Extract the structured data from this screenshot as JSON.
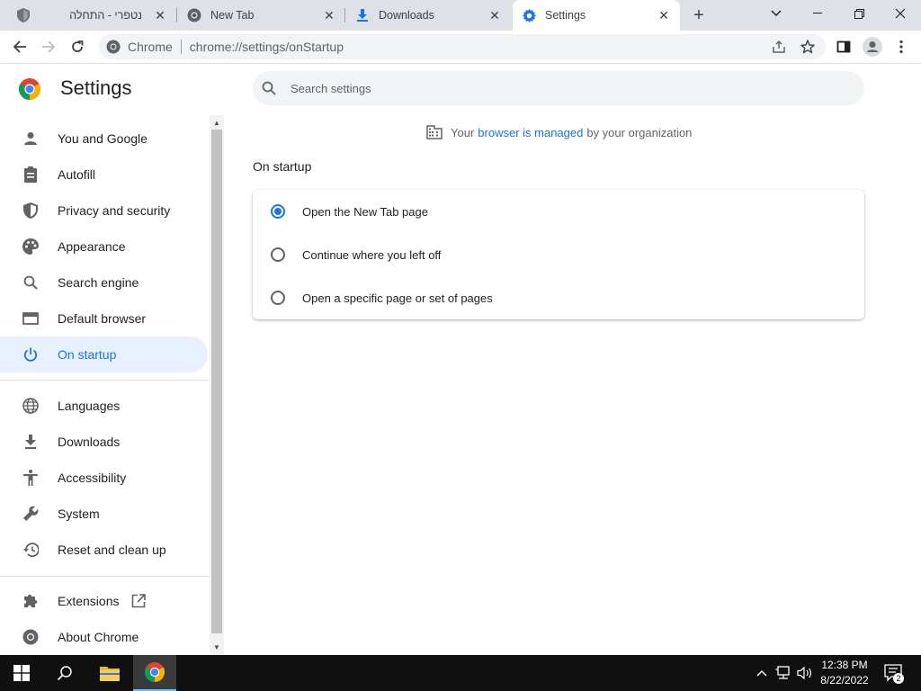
{
  "tabs": [
    {
      "title": "נטפרי - התחלה",
      "icon": "shield-icon"
    },
    {
      "title": "New Tab",
      "icon": "chrome-icon"
    },
    {
      "title": "Downloads",
      "icon": "download-icon"
    },
    {
      "title": "Settings",
      "icon": "gear-icon",
      "active": true
    }
  ],
  "omnibox": {
    "site": "Chrome",
    "url": "chrome://settings/onStartup"
  },
  "settings": {
    "title": "Settings",
    "search_placeholder": "Search settings",
    "managed": {
      "prefix": "Your",
      "link": "browser is managed",
      "suffix": "by your organization"
    },
    "nav": [
      {
        "label": "You and Google",
        "icon": "person-icon"
      },
      {
        "label": "Autofill",
        "icon": "clipboard-icon"
      },
      {
        "label": "Privacy and security",
        "icon": "shield-icon"
      },
      {
        "label": "Appearance",
        "icon": "palette-icon"
      },
      {
        "label": "Search engine",
        "icon": "search-icon"
      },
      {
        "label": "Default browser",
        "icon": "browser-icon"
      },
      {
        "label": "On startup",
        "icon": "power-icon",
        "active": true
      },
      {
        "label": "Languages",
        "icon": "globe-icon"
      },
      {
        "label": "Downloads",
        "icon": "download-icon"
      },
      {
        "label": "Accessibility",
        "icon": "accessibility-icon"
      },
      {
        "label": "System",
        "icon": "wrench-icon"
      },
      {
        "label": "Reset and clean up",
        "icon": "restore-icon"
      },
      {
        "label": "Extensions",
        "icon": "puzzle-icon"
      },
      {
        "label": "About Chrome",
        "icon": "chrome-icon"
      }
    ],
    "section_title": "On startup",
    "options": [
      {
        "label": "Open the New Tab page",
        "checked": true
      },
      {
        "label": "Continue where you left off",
        "checked": false
      },
      {
        "label": "Open a specific page or set of pages",
        "checked": false
      }
    ]
  },
  "taskbar": {
    "time": "12:38 PM",
    "date": "8/22/2022",
    "notifications": "2"
  },
  "colors": {
    "accent": "#1a73e8",
    "active_nav_bg": "#e8f0fe",
    "tabstrip": "#dee1e6"
  }
}
